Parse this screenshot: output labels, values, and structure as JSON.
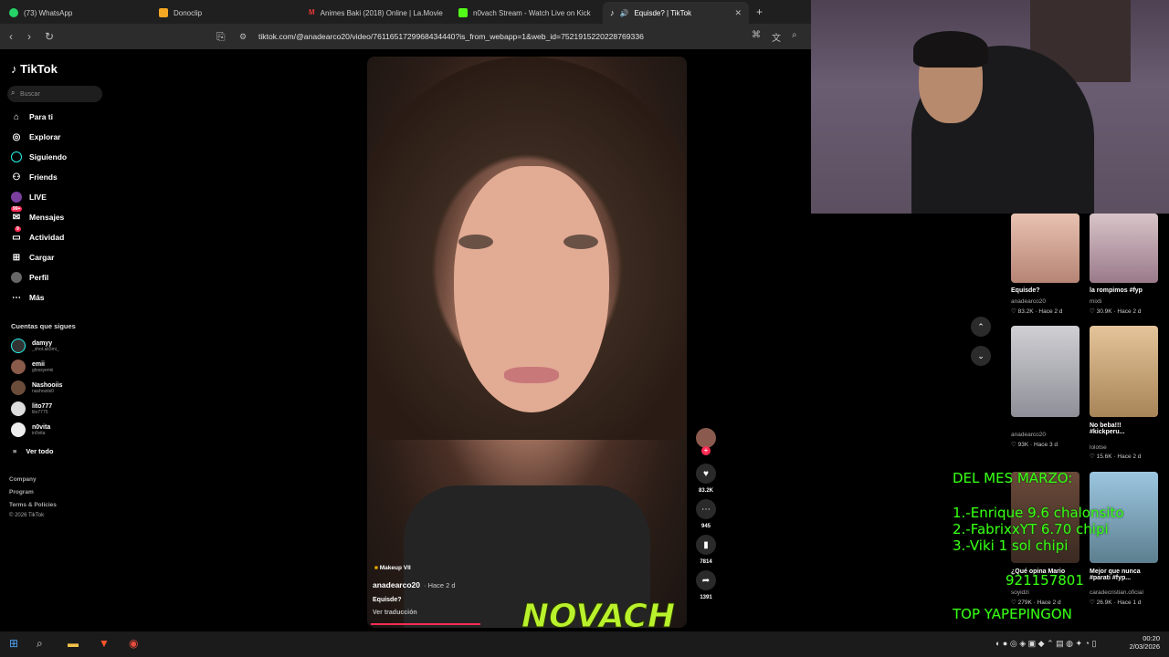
{
  "browser": {
    "tabs": [
      {
        "label": "(73) WhatsApp",
        "color": "#25d366"
      },
      {
        "label": "Donoclip",
        "color": "#f5a623"
      },
      {
        "label": "Animes Baki (2018) Online | La.Movie",
        "color": "#e53935"
      },
      {
        "label": "n0vach Stream - Watch Live on Kick",
        "color": "#53fc18"
      },
      {
        "label": "Equisde? | TikTok",
        "color": "#ffffff"
      }
    ],
    "url": "tiktok.com/@anadearco20/video/7611651729968434440?is_from_webapp=1&web_id=7521915220228769336"
  },
  "tiktok": {
    "logo": "TikTok",
    "search_placeholder": "Buscar",
    "nav": [
      {
        "label": "Para ti",
        "icon": "home-icon"
      },
      {
        "label": "Explorar",
        "icon": "compass-icon"
      },
      {
        "label": "Siguiendo",
        "icon": "following-icon"
      },
      {
        "label": "Friends",
        "icon": "friends-icon"
      },
      {
        "label": "LIVE",
        "icon": "live-icon"
      },
      {
        "label": "Mensajes",
        "icon": "messages-icon",
        "badge": "99+"
      },
      {
        "label": "Actividad",
        "icon": "activity-icon",
        "badge": "9"
      },
      {
        "label": "Cargar",
        "icon": "upload-icon"
      },
      {
        "label": "Perfil",
        "icon": "profile-icon"
      },
      {
        "label": "Más",
        "icon": "more-icon"
      }
    ],
    "following_heading": "Cuentas que sigues",
    "following": [
      {
        "name": "damyy",
        "handle": "_shot.ak5mi_"
      },
      {
        "name": "emii",
        "handle": "glossyemii"
      },
      {
        "name": "Nashooiis",
        "handle": "nashooiis0"
      },
      {
        "name": "lito777",
        "handle": "lito7775"
      },
      {
        "name": "n0vita",
        "handle": "in0vita"
      }
    ],
    "see_all": "Ver todo",
    "footer": [
      "Company",
      "Program",
      "Terms & Policies",
      "© 2026 TikTok"
    ],
    "video": {
      "music": "Makeup VII",
      "author": "anadearco20",
      "time": "· Hace 2 d",
      "caption": "Equisde?",
      "translate": "Ver traducción",
      "likes": "83.2K",
      "comments": "945",
      "saves": "7814",
      "shares": "1391"
    }
  },
  "recommended": [
    {
      "caption": "Equisde?",
      "user": "anadearco20",
      "stats": "83.2K · Hace 2 d"
    },
    {
      "caption": "la rompimos #fyp",
      "user": "mixti",
      "stats": "30.9K · Hace 2 d"
    },
    {
      "caption": "",
      "user": "anadearco20",
      "stats": "93K · Hace 3 d"
    },
    {
      "caption": "No beba!!! #kickperu...",
      "user": "lolotse",
      "stats": "15.6K · Hace 2 d"
    },
    {
      "caption": "¿Qué opina Mario",
      "user": "soyidzi",
      "stats": "279K · Hace 2 d"
    },
    {
      "caption": "Mejor que nunca #parati #fyp...",
      "user": "caradecristian.oficial",
      "stats": "26.9K · Hace 1 d"
    }
  ],
  "overlay": {
    "title": "DEL MES MARZO:",
    "lines": [
      "1.-Enrique 9.6 chalonsito",
      "2.-FabrixxYT 6.70 chipi",
      "3.-Viki 1 sol chipi"
    ],
    "phone": "921157801",
    "top": "TOP YAPEPINGON",
    "brand": "NOVACH"
  },
  "taskbar": {
    "time": "00:20",
    "date": "2/03/2026"
  }
}
